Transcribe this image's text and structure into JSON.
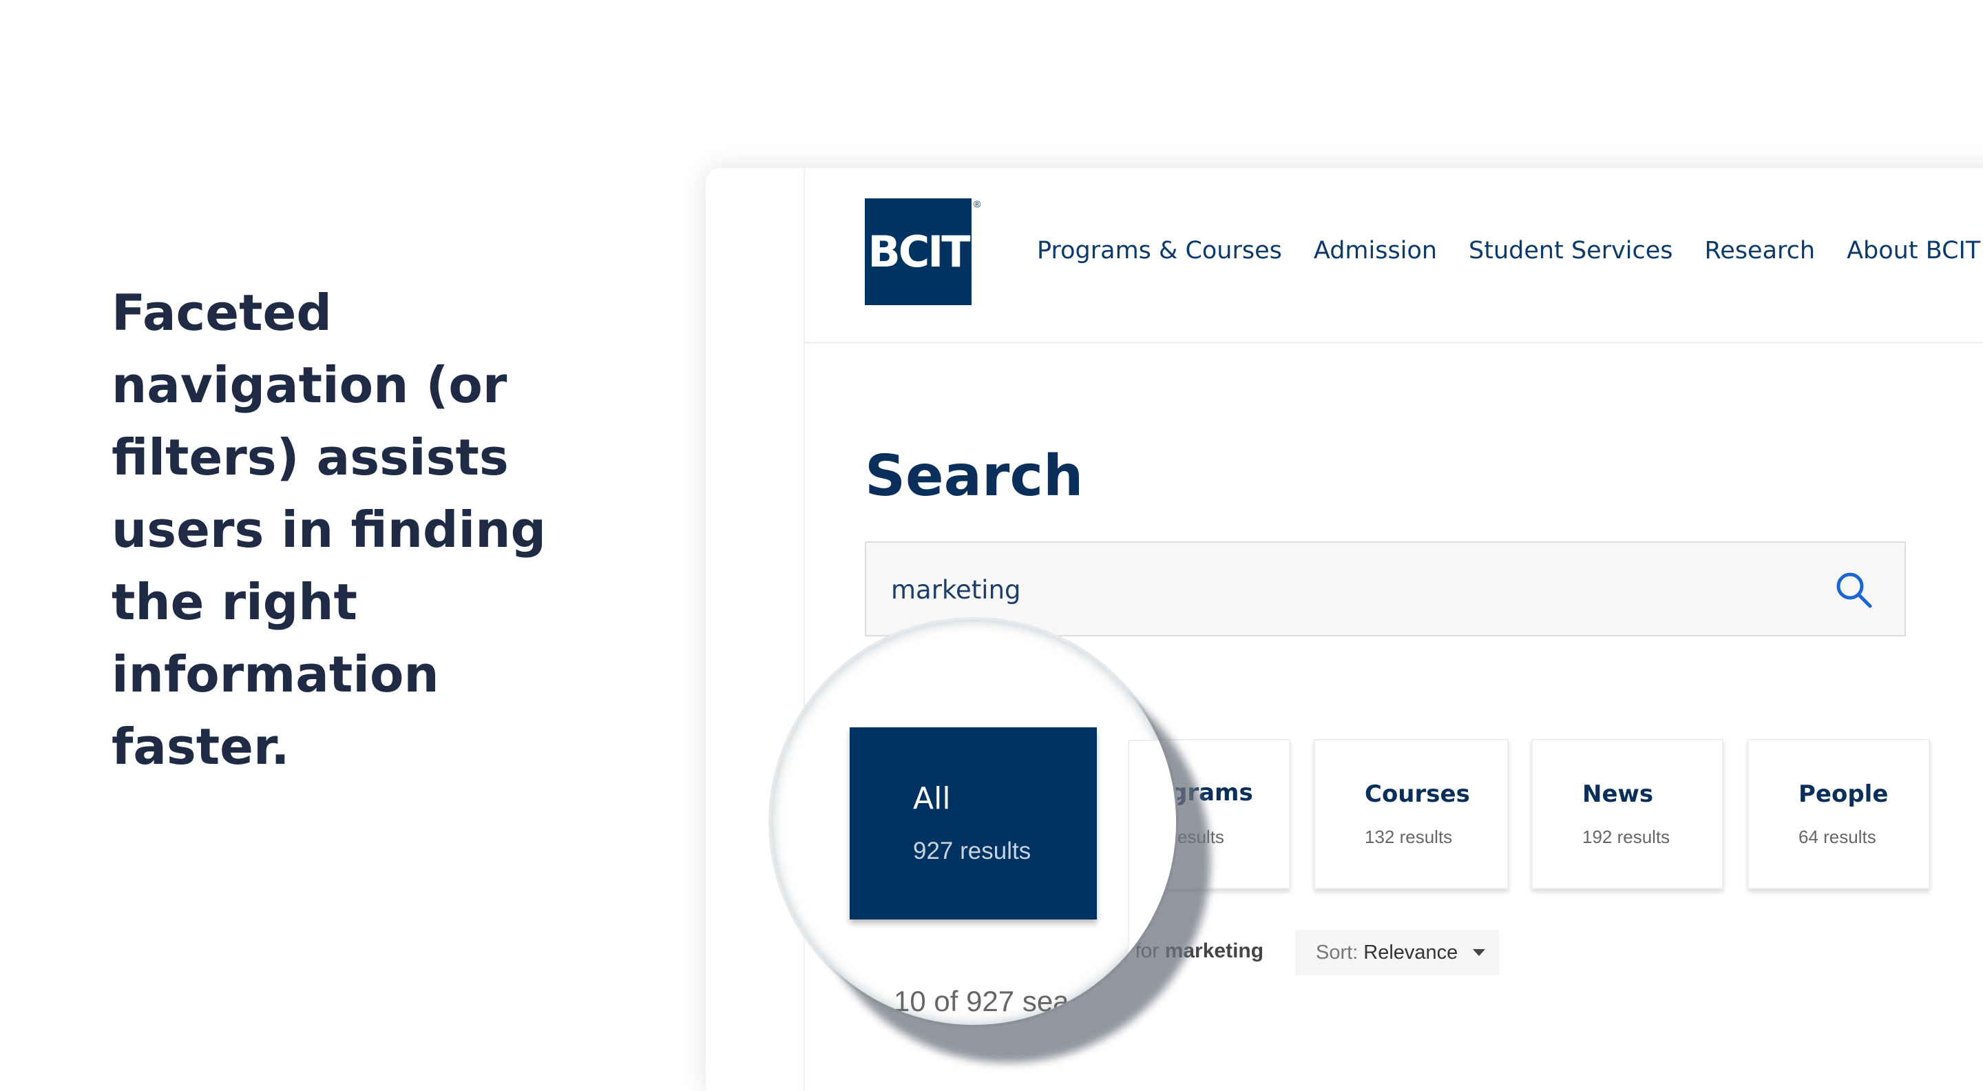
{
  "headline": "Faceted navigation (or filters) assists users in finding the right information faster.",
  "site": {
    "logo_text": "BCIT",
    "logo_mark": "®",
    "nav": [
      "Programs & Courses",
      "Admission",
      "Student Services",
      "Research",
      "About BCIT"
    ]
  },
  "page_title": "Search",
  "search": {
    "value": "marketing",
    "icon": "search-icon"
  },
  "tabs": {
    "all": {
      "label": "All",
      "count": "927 results",
      "selected": true
    },
    "programs": {
      "label_visible": "grams",
      "count_visible": "esults"
    },
    "courses": {
      "label": "Courses",
      "count": "132 results"
    },
    "news": {
      "label": "News",
      "count": "192 results"
    },
    "people": {
      "label": "People",
      "count": "64 results"
    }
  },
  "results_for": {
    "prefix_visible": "s for ",
    "query": "marketing"
  },
  "sort": {
    "label": "Sort:",
    "value": "Relevance"
  },
  "result_count_visible": "10 of 927 sea",
  "colors": {
    "brand_navy": "#003262",
    "headline": "#1f2a44",
    "nav_text": "#0b3a6b"
  }
}
